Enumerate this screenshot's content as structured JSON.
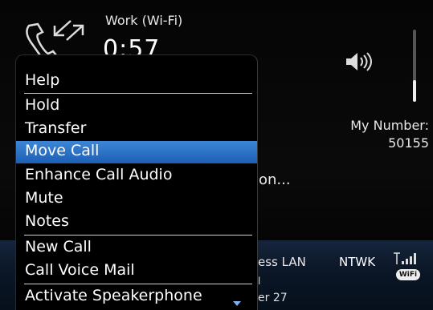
{
  "call": {
    "label": "Work (Wi-Fi)",
    "timer": "0:57",
    "status_text": "on..."
  },
  "my_number": {
    "label": "My Number:",
    "value": "50155"
  },
  "volume": {
    "level": 0.3
  },
  "bottom_bar": {
    "network_name": "ess LAN",
    "carrier": "NTWK",
    "wifi_badge": "WiFi",
    "sub_line_1": "l",
    "sub_line_2": "er 27"
  },
  "menu": {
    "items": [
      {
        "label": "Help",
        "selected": false
      },
      {
        "label": "Hold",
        "selected": false
      },
      {
        "label": "Transfer",
        "selected": false
      },
      {
        "label": "Move Call",
        "selected": true
      },
      {
        "label": "Enhance Call Audio",
        "selected": false
      },
      {
        "label": "Mute",
        "selected": false
      },
      {
        "label": "Notes",
        "selected": false
      },
      {
        "label": "New Call",
        "selected": false
      },
      {
        "label": "Call Voice Mail",
        "selected": false
      },
      {
        "label": "Activate Speakerphone",
        "selected": false
      }
    ]
  },
  "colors": {
    "selection": "#1d5fb5",
    "background": "#000000",
    "bottom_bar": "#0b1626"
  }
}
